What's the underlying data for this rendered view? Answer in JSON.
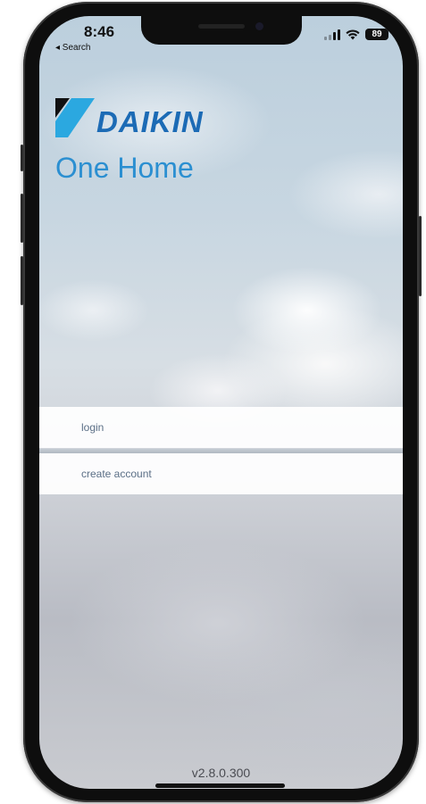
{
  "status_bar": {
    "time": "8:46",
    "back_label": "◂ Search",
    "battery_level": "89",
    "signal_icon": "cellular-signal-icon",
    "wifi_icon": "wifi-icon"
  },
  "branding": {
    "brand_name": "DAIKIN",
    "app_name": "One Home",
    "brand_color": "#1c6bb5",
    "title_color": "#2b8fd1"
  },
  "menu": {
    "login_label": "login",
    "create_account_label": "create account"
  },
  "footer": {
    "version": "v2.8.0.300"
  }
}
